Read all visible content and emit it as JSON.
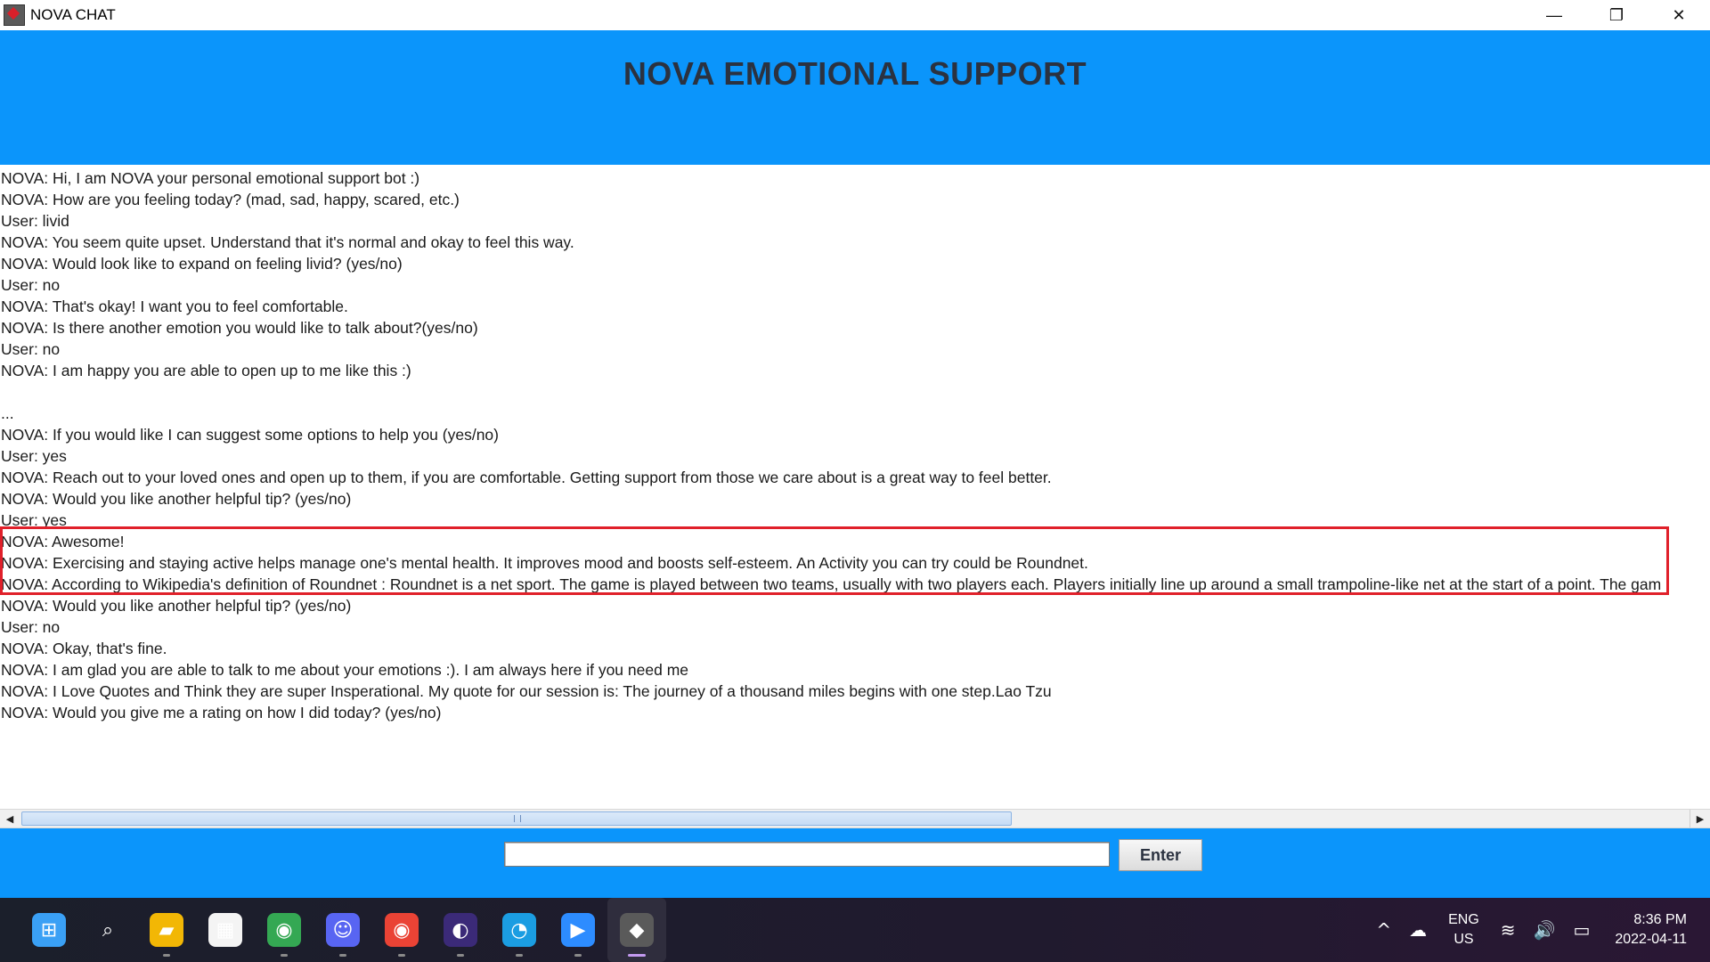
{
  "window": {
    "title": "NOVA CHAT",
    "controls": {
      "minimize": "—",
      "restore": "❐",
      "close": "✕"
    }
  },
  "header": {
    "title": "NOVA EMOTIONAL SUPPORT"
  },
  "chat": {
    "lines": [
      "NOVA: Hi, I am NOVA your personal emotional support bot :)",
      "NOVA: How are you feeling today? (mad, sad, happy, scared, etc.)",
      "User: livid",
      "NOVA: You seem quite upset. Understand that it's normal and okay to feel this way.",
      "NOVA: Would look like to expand on feeling livid? (yes/no)",
      "User: no",
      "NOVA: That's okay! I want you to feel comfortable.",
      "NOVA: Is there another emotion you would like to talk about?(yes/no)",
      "User: no",
      "NOVA: I am happy you are able to open up to me like this :)",
      "",
      "...",
      "NOVA: If you would like I can suggest some options to help you (yes/no)",
      "User: yes",
      "NOVA: Reach out to your loved ones and open up to them, if you are comfortable. Getting support from those we care about is a great way to feel better.",
      "NOVA: Would you like another helpful tip? (yes/no)",
      "User: yes",
      "NOVA: Awesome!",
      "NOVA: Exercising and staying active helps manage one's mental health. It improves mood and boosts self-esteem. An Activity you can try could be Roundnet.",
      "NOVA: According to Wikipedia's definition of Roundnet :  Roundnet is a net sport. The game is played between two teams, usually with two players each. Players initially line up around a small trampoline-like net at the start of a point. The gam",
      "NOVA: Would you like another helpful tip? (yes/no)",
      "User: no",
      "NOVA: Okay, that's fine.",
      "NOVA: I am glad you are able to talk to me about your emotions :). I am always here if you need me",
      "NOVA: I Love Quotes and Think they are super Insperational. My quote for our session is: The journey of a thousand miles begins with one step.Lao Tzu",
      "NOVA: Would you give me a rating on how I did today? (yes/no)"
    ],
    "highlight_color": "#e0202a"
  },
  "scrollbar": {
    "left_arrow": "◀",
    "right_arrow": "▶"
  },
  "input": {
    "value": "",
    "enter_label": "Enter"
  },
  "taskbar": {
    "apps": [
      {
        "name": "start-icon",
        "glyph": "⊞",
        "color": "#3aa0f5"
      },
      {
        "name": "search-icon",
        "glyph": "⌕",
        "color": "transparent"
      },
      {
        "name": "file-explorer-icon",
        "glyph": "▰",
        "color": "#f2b705"
      },
      {
        "name": "microsoft-store-icon",
        "glyph": "▦",
        "color": "#f4f4f4"
      },
      {
        "name": "chrome-icon",
        "glyph": "◉",
        "color": "#34a853"
      },
      {
        "name": "discord-icon",
        "glyph": "☺",
        "color": "#5865f2"
      },
      {
        "name": "chrome-profile-icon",
        "glyph": "◉",
        "color": "#ea4335"
      },
      {
        "name": "eclipse-icon",
        "glyph": "◐",
        "color": "#3b2a78"
      },
      {
        "name": "edge-icon",
        "glyph": "◔",
        "color": "#1b9de2"
      },
      {
        "name": "zoom-icon",
        "glyph": "▶",
        "color": "#2d8cff"
      },
      {
        "name": "java-app-icon",
        "glyph": "◆",
        "color": "#5a5a5a"
      }
    ],
    "language": {
      "top": "ENG",
      "bottom": "US"
    },
    "clock": {
      "time": "8:36 PM",
      "date": "2022-04-11"
    },
    "tray_icons": {
      "chevron": "^",
      "cloud": "☁",
      "wifi": "≋",
      "volume": "🔊",
      "battery": "▭"
    }
  }
}
